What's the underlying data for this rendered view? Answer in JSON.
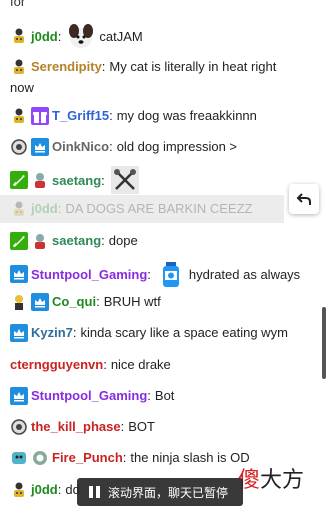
{
  "top_cut_text": "for",
  "messages": [
    {
      "user": "j0dd",
      "color": "#1e8a1e",
      "badges": [
        "sub"
      ],
      "emote": "dog",
      "text": "catJAM"
    },
    {
      "user": "Serendipity",
      "color": "#b5832a",
      "badges": [
        "sub"
      ],
      "text": "My cat is literally in heat right",
      "text2": "now"
    },
    {
      "user": "T_Griff15",
      "color": "#2d64d6",
      "badges": [
        "sub",
        "gift"
      ],
      "text": "my dog was freaakkinnn"
    },
    {
      "user": "OinkNico",
      "color": "#666666",
      "badges": [
        "sub2",
        "prime"
      ],
      "text": "old dog impression >"
    },
    {
      "user": "saetang",
      "color": "#2e8b57",
      "badges": [
        "mod",
        "sub3"
      ],
      "emote": "cross",
      "text": ""
    },
    {
      "user": "j0dd",
      "color": "#1e8a1e",
      "badges": [
        "sub"
      ],
      "text": "DA DOGS ARE BARKIN CEEZZ"
    },
    {
      "user": "saetang",
      "color": "#2e8b57",
      "badges": [
        "mod",
        "sub3"
      ],
      "text": "dope"
    },
    {
      "user": "Stuntpool_Gaming",
      "color": "#8a2be2",
      "badges": [
        "prime"
      ],
      "emote": "bottle",
      "text": "hydrated as always"
    },
    {
      "user": "Co_qui",
      "color": "#1e8a1e",
      "badges": [
        "sub4",
        "prime"
      ],
      "text": "BRUH wtf"
    },
    {
      "user": "Kyzin7",
      "color": "#2e6e9e",
      "badges": [
        "prime"
      ],
      "text": "kinda scary like a space eating wym"
    },
    {
      "user": "cterngguyenvn",
      "color": "#cc2222",
      "badges": [],
      "text": "nice drake"
    },
    {
      "user": "Stuntpool_Gaming",
      "color": "#8a2be2",
      "badges": [
        "prime"
      ],
      "text": "Bot"
    },
    {
      "user": "the_kill_phase",
      "color": "#cc2222",
      "badges": [
        "sub2"
      ],
      "text": "BOT"
    },
    {
      "user": "Fire_Punch",
      "color": "#cc2222",
      "badges": [
        "sub5",
        "sub6"
      ],
      "text": "the ninja slash is OD"
    },
    {
      "user": "j0dd",
      "color": "#1e8a1e",
      "badges": [
        "sub"
      ],
      "text": "dd"
    }
  ],
  "pause_banner": "滚动界面，聊天已暂停",
  "watermark_red": "傻",
  "watermark_black": "大方",
  "colors": {
    "prime": "#1e8fde",
    "mod": "#34ae0a"
  }
}
